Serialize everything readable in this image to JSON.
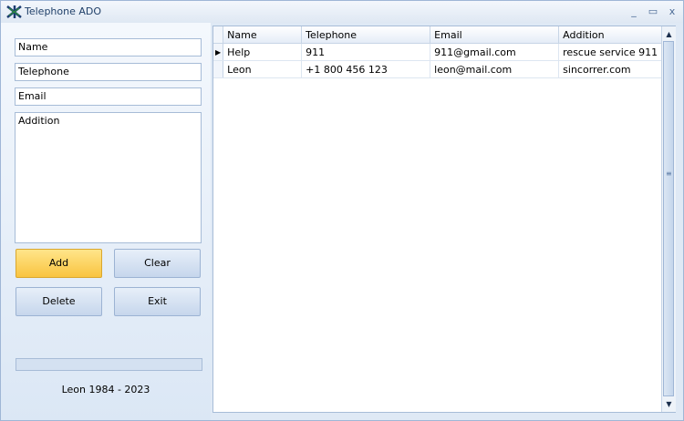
{
  "window": {
    "title": "Telephone ADO",
    "minimize": "_",
    "maximize": "▭",
    "close": "x"
  },
  "form": {
    "name": "Name",
    "telephone": "Telephone",
    "email": "Email",
    "addition": "Addition",
    "buttons": {
      "add": "Add",
      "clear": "Clear",
      "delete": "Delete",
      "exit": "Exit"
    },
    "progress": 0,
    "footer": "Leon 1984 - 2023"
  },
  "grid": {
    "columns": [
      "Name",
      "Telephone",
      "Email",
      "Addition"
    ],
    "rows": [
      [
        "Help",
        "911",
        "911@gmail.com",
        "rescue service 911"
      ],
      [
        "Leon",
        "+1 800 456 123",
        "leon@mail.com",
        "sincorrer.com"
      ]
    ],
    "current_row": "▶"
  },
  "colors": {
    "add_button": "#f9c440",
    "window_bg": "#dfe9f5",
    "grid_border": "#a7bcd7"
  }
}
